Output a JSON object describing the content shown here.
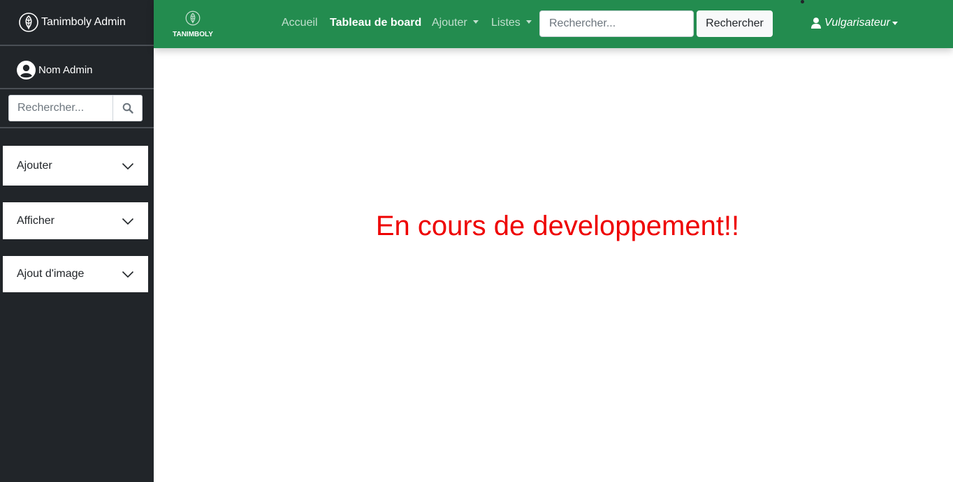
{
  "sidebar": {
    "brand": "Tanimboly Admin",
    "user_name": "Nom Admin",
    "search_placeholder": "Rechercher...",
    "menu": [
      {
        "label": "Ajouter"
      },
      {
        "label": "Afficher"
      },
      {
        "label": "Ajout d'image"
      }
    ]
  },
  "topbar": {
    "logo_text": "TANIMBOLY",
    "nav": [
      {
        "label": "Accueil"
      },
      {
        "label": "Tableau de board"
      },
      {
        "label": "Ajouter"
      },
      {
        "label": "Listes"
      }
    ],
    "search_placeholder": "Rechercher...",
    "search_button": "Rechercher",
    "user_menu": "Vulgarisateur"
  },
  "main": {
    "message": "En cours de developpement!!"
  },
  "colors": {
    "sidebar_bg": "#212529",
    "topbar_bg": "#238c4f",
    "message": "#ee0000"
  },
  "icons": [
    "leaf-logo-icon",
    "user-circle-icon",
    "search-icon",
    "chevron-down-icon",
    "user-icon"
  ]
}
